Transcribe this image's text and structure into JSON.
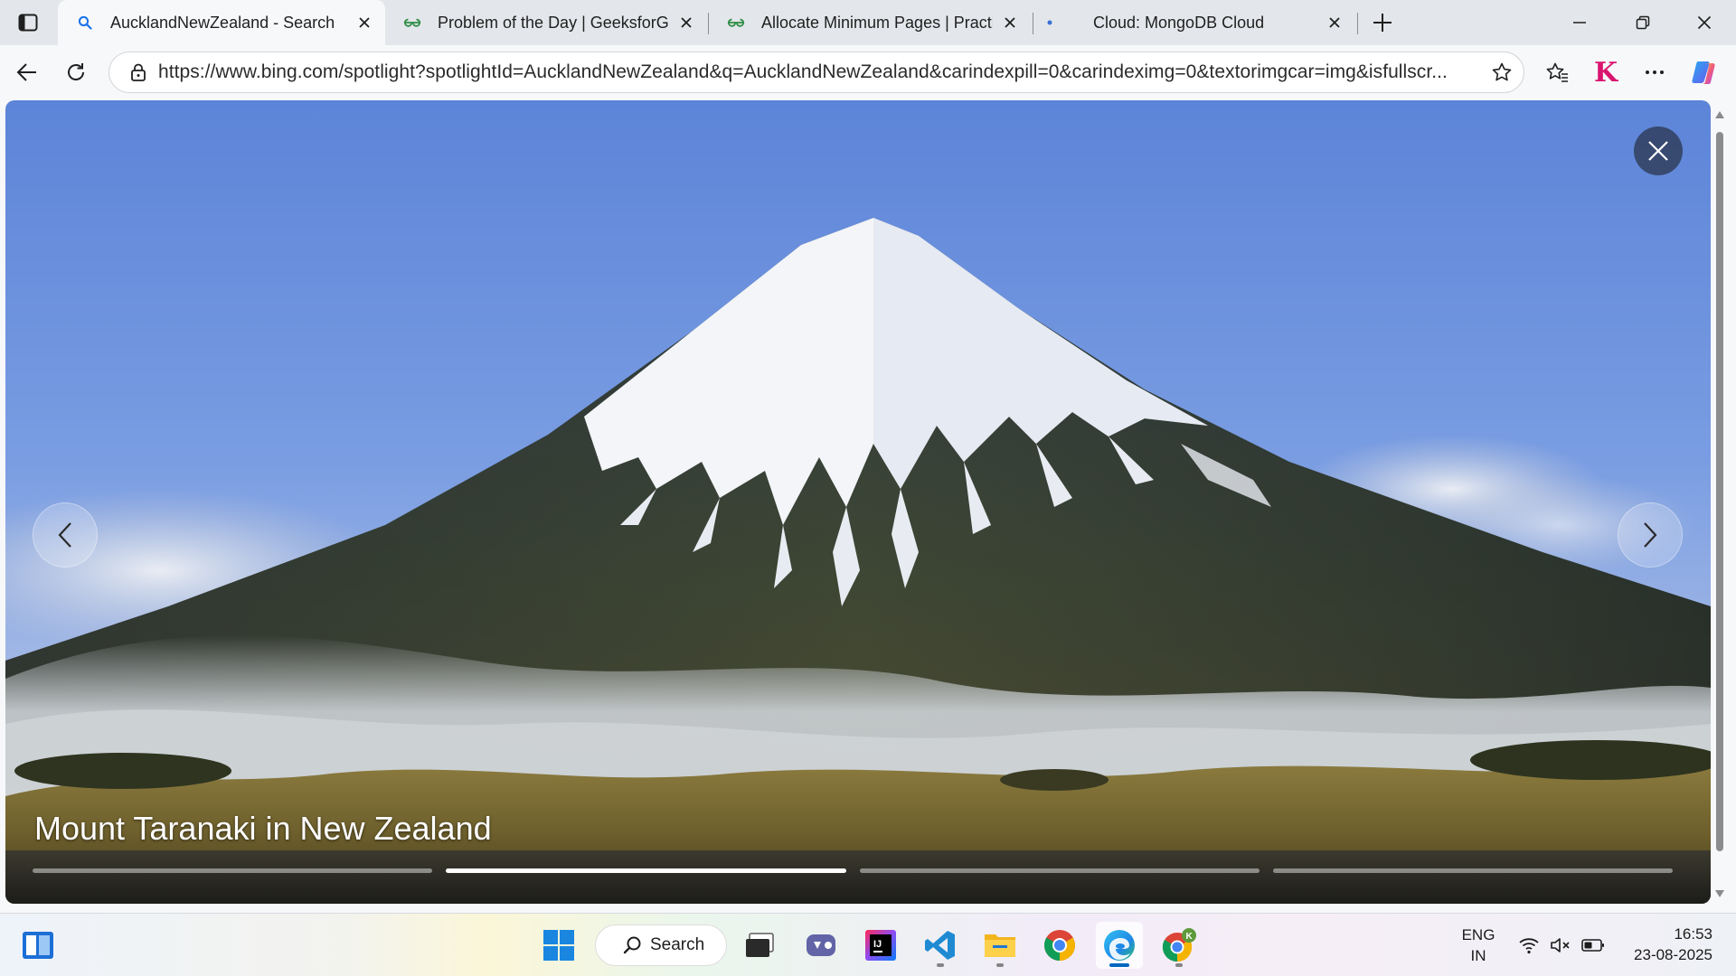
{
  "browser": {
    "tabs": [
      {
        "title": "AucklandNewZealand - Search",
        "favicon": "search-icon",
        "active": true
      },
      {
        "title": "Problem of the Day | GeeksforGeeks",
        "favicon": "geeksforgeeks-icon",
        "active": false
      },
      {
        "title": "Allocate Minimum Pages | Practice",
        "favicon": "geeksforgeeks-icon",
        "active": false
      },
      {
        "title": "Cloud: MongoDB Cloud",
        "favicon": "mongodb-dot-icon",
        "active": false
      }
    ],
    "address_url": "https://www.bing.com/spotlight?spotlightId=AucklandNewZealand&q=AucklandNewZealand&carindexpill=0&carindeximg=0&textorimgcar=img&isfullscr...",
    "profile_badge": "K"
  },
  "spotlight": {
    "caption": "Mount Taranaki in New Zealand",
    "slide_count": 4,
    "active_slide": 2
  },
  "taskbar": {
    "search_label": "Search",
    "apps": [
      "file-manager-icon",
      "teams-icon",
      "intellij-icon",
      "vscode-icon",
      "file-explorer-icon",
      "chrome-icon",
      "edge-icon",
      "chrome-profile-icon"
    ],
    "intellij_text": "IJ",
    "chrome_profile_badge": "K"
  },
  "system_tray": {
    "language_line1": "ENG",
    "language_line2": "IN",
    "time": "16:53",
    "date": "23-08-2025"
  }
}
